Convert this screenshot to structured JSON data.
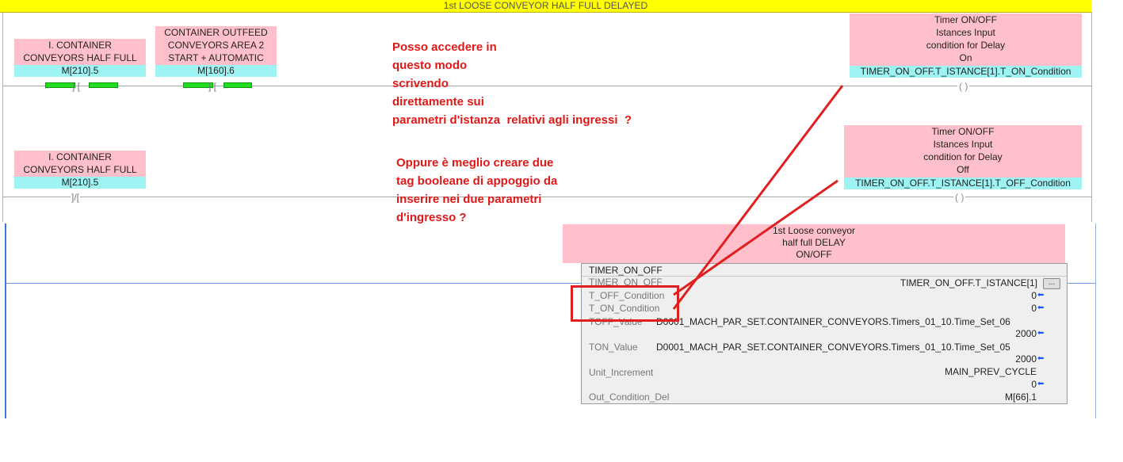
{
  "rung_title": "1st LOOSE CONVEYOR HALF FULL DELAYED",
  "rung1": {
    "contact1": {
      "label_line1": "I. CONTAINER",
      "label_line2": "CONVEYORS HALF FULL",
      "address": "M[210].5"
    },
    "contact2": {
      "label_line1": "CONTAINER OUTFEED",
      "label_line2": "CONVEYORS AREA 2",
      "label_line3": "START + AUTOMATIC",
      "address": "M[160].6"
    },
    "coil": {
      "label_line1": "Timer ON/OFF",
      "label_line2": "Istances Input",
      "label_line3": "condition for Delay",
      "label_line4": "On",
      "address": "TIMER_ON_OFF.T_ISTANCE[1].T_ON_Condition",
      "symbol": "( )"
    }
  },
  "rung2": {
    "contact1": {
      "label_line1": "I. CONTAINER",
      "label_line2": "CONVEYORS HALF FULL",
      "address": "M[210].5",
      "symbol": "]/["
    },
    "coil": {
      "label_line1": "Timer ON/OFF",
      "label_line2": "Istances Input",
      "label_line3": "condition for Delay",
      "label_line4": "Off",
      "address": "TIMER_ON_OFF.T_ISTANCE[1].T_OFF_Condition",
      "symbol": "( )"
    }
  },
  "notes": {
    "note1": [
      "Posso accedere in",
      "questo modo",
      "scrivendo",
      "direttamente sui",
      "parametri d'istanza  relativi agli ingressi  ?"
    ],
    "note2": [
      "Oppure è meglio creare due",
      "tag booleane di appoggio da",
      "inserire nei due parametri",
      "d'ingresso ?"
    ]
  },
  "function_block": {
    "comment_line1": "1st Loose conveyor",
    "comment_line2": "half full DELAY",
    "comment_line3": "ON/OFF",
    "type": "TIMER_ON_OFF",
    "instance_label": "TIMER_ON_OFF",
    "instance_value": "TIMER_ON_OFF.T_ISTANCE[1]",
    "dots_label": "...",
    "params": {
      "t_off_condition": {
        "name": "T_OFF_Condition",
        "value": "0"
      },
      "t_on_condition": {
        "name": "T_ON_Condition",
        "value": "0"
      },
      "toff_value": {
        "name": "TOFF_Value",
        "source": "D0001_MACH_PAR_SET.CONTAINER_CONVEYORS.Timers_01_10.Time_Set_06",
        "value": "2000"
      },
      "ton_value": {
        "name": "TON_Value",
        "source": "D0001_MACH_PAR_SET.CONTAINER_CONVEYORS.Timers_01_10.Time_Set_05",
        "value": "2000"
      },
      "unit_increment": {
        "name": "Unit_Increment",
        "source": "MAIN_PREV_CYCLE",
        "value": "0"
      },
      "out_condition_del": {
        "name": "Out_Condition_Del",
        "value": "M[66].1"
      }
    },
    "arrow_glyph": "⬅"
  },
  "colors": {
    "title_bar": "#ffff00",
    "label_pink": "#ffc0cb",
    "address_cyan": "#9ef3f3",
    "contact_on_green": "#22dd22",
    "annotation_red": "#e01818",
    "value_arrow_blue": "#2255ff"
  }
}
